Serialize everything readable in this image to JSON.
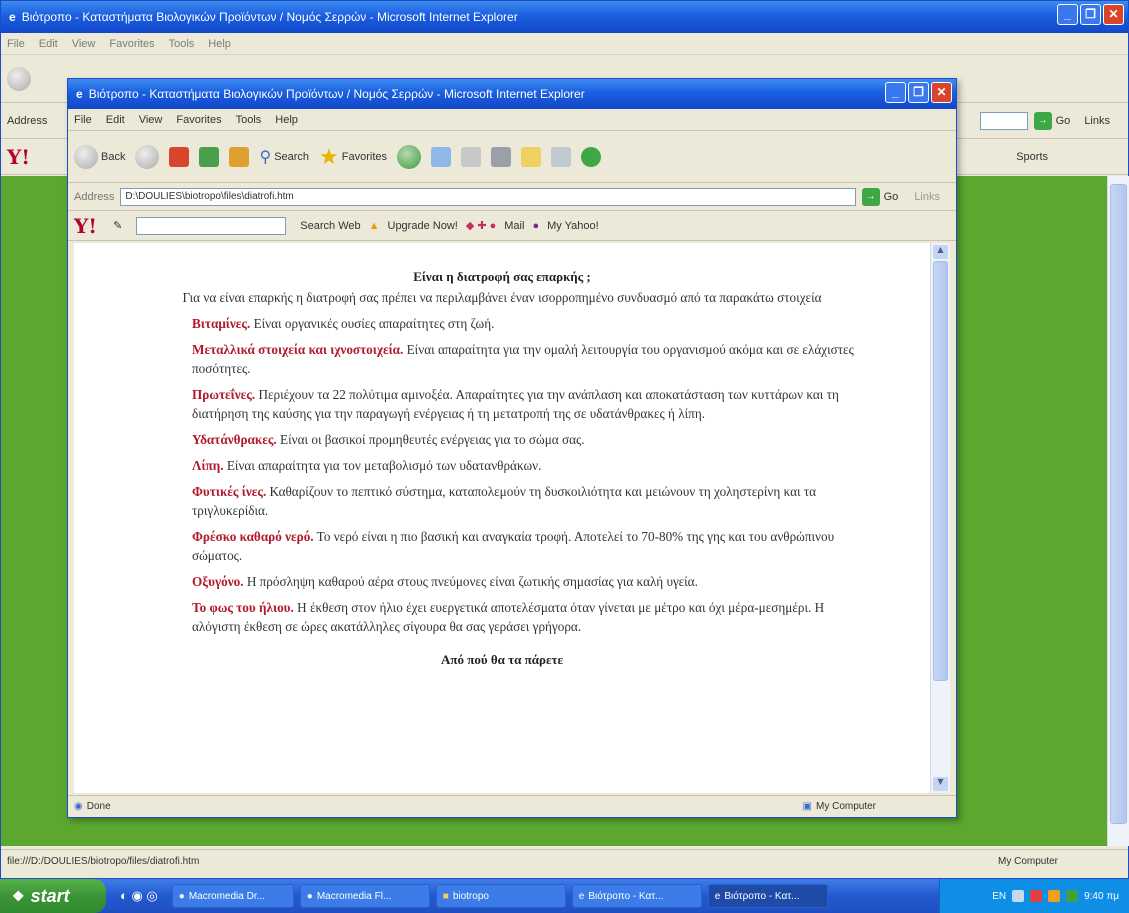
{
  "outer_window": {
    "title": "Βιότροπο - Καταστήματα Βιολογικών Προϊόντων / Νομός Σερρών - Microsoft Internet Explorer",
    "menu": [
      "File",
      "Edit",
      "View",
      "Favorites",
      "Tools",
      "Help"
    ],
    "address_label": "Address",
    "go_label": "Go",
    "links_label": "Links",
    "sports_label": "Sports",
    "status_text": "file:///D:/DOULIES/biotropo/files/diatrofi.htm",
    "zone_label": "My Computer"
  },
  "inner_window": {
    "title": "Βιότροπο - Καταστήματα Βιολογικών Προϊόντων / Νομός Σερρών - Microsoft Internet Explorer",
    "menu": [
      "File",
      "Edit",
      "View",
      "Favorites",
      "Tools",
      "Help"
    ],
    "toolbar": {
      "back": "Back",
      "search": "Search",
      "favorites": "Favorites"
    },
    "address_label": "Address",
    "address_value": "D:\\DOULIES\\biotropo\\files\\diatrofi.htm",
    "go_label": "Go",
    "links_label": "Links",
    "yahoo_bar": {
      "logo": "Y!",
      "search_web": "Search Web",
      "upgrade": "Upgrade Now!",
      "mail": "Mail",
      "my_yahoo": "My Yahoo!"
    },
    "status_text": "Done",
    "zone_label": "My Computer"
  },
  "page": {
    "heading": "Είναι η διατροφή σας επαρκής ;",
    "intro": "Για να είναι επαρκής η διατροφή σας πρέπει να περιλαμβάνει έναν ισορροπημένο συνδυασμό από τα παρακάτω στοιχεία",
    "items": [
      {
        "term": "Βιταμίνες.",
        "text": " Είναι οργανικές ουσίες απαραίτητες στη ζωή."
      },
      {
        "term": "Μεταλλικά στοιχεία και ιχνοστοιχεία.",
        "text": " Είναι απαραίτητα για την ομαλή λειτουργία του οργανισμού ακόμα και σε ελάχιστες ποσότητες."
      },
      {
        "term": "Πρωτεΐνες.",
        "text": " Περιέχουν τα 22 πολύτιμα αμινοξέα. Απαραίτητες για την ανάπλαση και αποκατάσταση των κυττάρων και τη διατήρηση της καύσης για την παραγωγή ενέργειας ή τη μετατροπή της σε υδατάνθρακες ή λίπη."
      },
      {
        "term": "Υδατάνθρακες.",
        "text": " Είναι οι βασικοί προμηθευτές ενέργειας για το σώμα σας."
      },
      {
        "term": "Λίπη.",
        "text": " Είναι απαραίτητα για τον μεταβολισμό των υδατανθράκων."
      },
      {
        "term": "Φυτικές ίνες.",
        "text": " Καθαρίζουν το πεπτικό σύστημα, καταπολεμούν τη δυσκοιλιότητα και μειώνουν τη χοληστερίνη και τα τριγλυκερίδια."
      },
      {
        "term": "Φρέσκο καθαρό νερό.",
        "text": " Το νερό είναι η πιο βασική και αναγκαία τροφή. Αποτελεί το 70-80% της γης και του ανθρώπινου σώματος."
      },
      {
        "term": "Οξυγόνο.",
        "text": " Η πρόσληψη καθαρού αέρα στους πνεύμονες είναι ζωτικής σημασίας για καλή υγεία."
      },
      {
        "term": "Το φως του ήλιου.",
        "text": " Η έκθεση στον ήλιο έχει ευεργετικά αποτελέσματα όταν γίνεται με μέτρο και όχι μέρα-μεσημέρι. Η αλόγιστη έκθεση σε ώρες ακατάλληλες σίγουρα θα σας γεράσει γρήγορα."
      }
    ],
    "subheading": "Από πού θα τα πάρετε"
  },
  "taskbar": {
    "start_label": "start",
    "tasks": [
      "Macromedia Dr...",
      "Macromedia Fl...",
      "biotropo",
      "Βιότροπο - Κατ...",
      "Βιότροπο - Κατ..."
    ],
    "lang": "EN",
    "clock": "9:40 πμ"
  }
}
